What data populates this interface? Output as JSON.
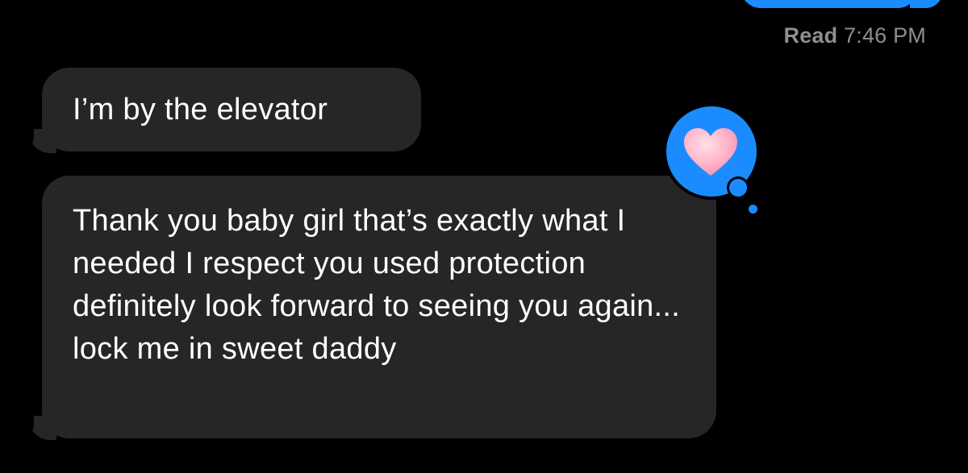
{
  "thread": {
    "read_receipt": {
      "status": "Read",
      "time": "7:46 PM"
    },
    "messages": [
      {
        "direction": "incoming",
        "text": "I’m by the elevator"
      },
      {
        "direction": "incoming",
        "text": "Thank you baby girl that’s exactly what I needed I respect you used protection definitely look forward to seeing you again... lock me in sweet daddy"
      }
    ],
    "reaction": {
      "icon": "heart-icon",
      "on_message": 0,
      "bubble_color": "#1a8cff",
      "heart_color": "#ffb3c8"
    }
  },
  "colors": {
    "background": "#000000",
    "incoming_bubble": "#262628",
    "sent_bubble": "#1a8cff",
    "receipt_text": "#8e8e93"
  }
}
